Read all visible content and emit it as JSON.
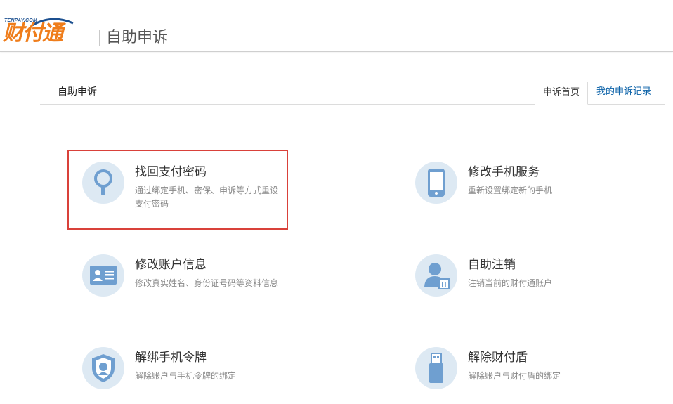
{
  "header": {
    "logo_small": "TENPAY.COM",
    "logo_text": "财付通",
    "title": "自助申诉"
  },
  "section": {
    "title": "自助申诉",
    "tabs": [
      {
        "label": "申诉首页",
        "active": true
      },
      {
        "label": "我的申诉记录",
        "active": false
      }
    ]
  },
  "services": [
    {
      "title": "找回支付密码",
      "desc": "通过绑定手机、密保、申诉等方式重设支付密码",
      "icon": "magnifier-icon",
      "highlighted": true
    },
    {
      "title": "修改手机服务",
      "desc": "重新设置绑定新的手机",
      "icon": "mobile-phone-icon"
    },
    {
      "title": "修改账户信息",
      "desc": "修改真实姓名、身份证号码等资料信息",
      "icon": "id-card-icon"
    },
    {
      "title": "自助注销",
      "desc": "注销当前的财付通账户",
      "icon": "user-delete-icon"
    },
    {
      "title": "解绑手机令牌",
      "desc": "解除账户与手机令牌的绑定",
      "icon": "shield-token-icon"
    },
    {
      "title": "解除财付盾",
      "desc": "解除账户与财付盾的绑定",
      "icon": "usb-key-icon"
    }
  ],
  "colors": {
    "icon_bg": "#dde9f3",
    "icon_fg": "#6f9fd0",
    "logo_orange": "#ef7d1b",
    "logo_blue": "#1b4f8f",
    "highlight": "#d9413a",
    "tab_link": "#0b62a8"
  }
}
